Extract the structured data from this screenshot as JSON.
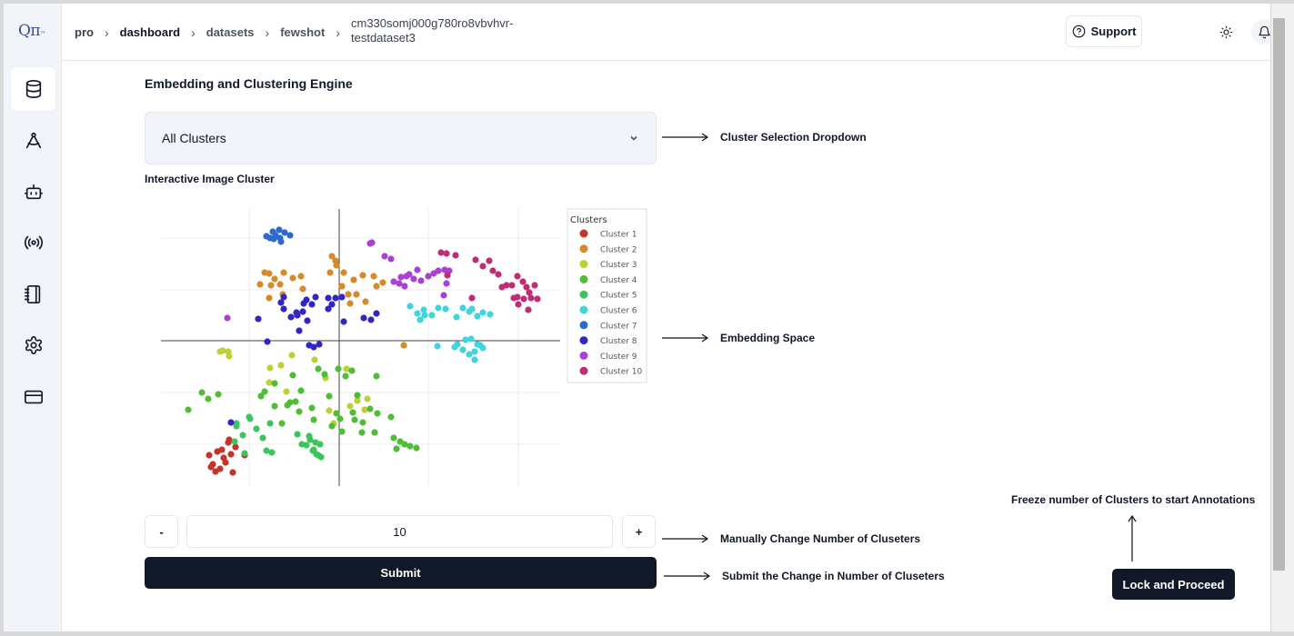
{
  "app": {
    "logo": "Qπ",
    "logo_sub": "™"
  },
  "breadcrumb": [
    "pro",
    "dashboard",
    "datasets",
    "fewshot",
    "cm330somj000g780ro8vbvhvr-testdataset3"
  ],
  "header": {
    "support_label": "Support"
  },
  "sidebar": {
    "items": [
      {
        "icon": "database-icon",
        "active": true
      },
      {
        "icon": "compass-icon",
        "active": false
      },
      {
        "icon": "bot-icon",
        "active": false
      },
      {
        "icon": "broadcast-icon",
        "active": false
      },
      {
        "icon": "notebook-icon",
        "active": false
      },
      {
        "icon": "settings-icon",
        "active": false
      },
      {
        "icon": "credit-card-icon",
        "active": false
      }
    ]
  },
  "main": {
    "title": "Embedding and Clustering Engine",
    "dropdown_value": "All Clusters",
    "cluster_title": "Interactive Image Cluster",
    "cluster_count": "10",
    "minus_label": "-",
    "plus_label": "+",
    "submit_label": "Submit",
    "lock_label": "Lock and Proceed"
  },
  "annotations": {
    "dropdown": "Cluster Selection Dropdown",
    "embedding": "Embedding Space",
    "change": "Manually Change Number of Cluseters",
    "submit": "Submit the Change in Number of Cluseters",
    "freeze": "Freeze number of Clusters to start Annotations"
  },
  "chart_data": {
    "type": "scatter",
    "legend_title": "Clusters",
    "legend_position": "right",
    "grid": true,
    "series": [
      {
        "name": "Cluster 1",
        "color": "#c4342a",
        "points": [
          [
            226,
            497
          ],
          [
            230,
            507
          ],
          [
            235,
            493
          ],
          [
            238,
            512
          ],
          [
            244,
            505
          ],
          [
            247,
            483
          ],
          [
            250,
            496
          ],
          [
            255,
            488
          ],
          [
            252,
            516
          ],
          [
            242,
            500
          ],
          [
            233,
            515
          ],
          [
            240,
            491
          ],
          [
            265,
            497
          ],
          [
            248,
            480
          ],
          [
            228,
            510
          ]
        ]
      },
      {
        "name": "Cluster 2",
        "color": "#d68a2c",
        "points": [
          [
            292,
            297
          ],
          [
            298,
            303
          ],
          [
            304,
            309
          ],
          [
            282,
            309
          ],
          [
            292,
            324
          ],
          [
            307,
            320
          ],
          [
            318,
            302
          ],
          [
            327,
            300
          ],
          [
            308,
            296
          ],
          [
            361,
            278
          ],
          [
            366,
            288
          ],
          [
            359,
            296
          ],
          [
            374,
            296
          ],
          [
            385,
            304
          ],
          [
            395,
            299
          ],
          [
            407,
            300
          ],
          [
            410,
            311
          ],
          [
            398,
            328
          ],
          [
            388,
            320
          ],
          [
            379,
            320
          ],
          [
            381,
            330
          ],
          [
            372,
            311
          ],
          [
            329,
            314
          ],
          [
            287,
            296
          ],
          [
            294,
            310
          ],
          [
            440,
            376
          ],
          [
            365,
            283
          ],
          [
            417,
            307
          ]
        ]
      },
      {
        "name": "Cluster 3",
        "color": "#bdd036",
        "points": [
          [
            241,
            382
          ],
          [
            248,
            388
          ],
          [
            238,
            383
          ],
          [
            342,
            392
          ],
          [
            377,
            402
          ],
          [
            317,
            387
          ],
          [
            305,
            398
          ],
          [
            293,
            401
          ],
          [
            292,
            417
          ],
          [
            311,
            427
          ],
          [
            400,
            435
          ],
          [
            389,
            437
          ],
          [
            381,
            443
          ],
          [
            397,
            447
          ],
          [
            363,
            462
          ],
          [
            354,
            412
          ],
          [
            358,
            448
          ],
          [
            247,
            383
          ]
        ]
      },
      {
        "name": "Cluster 4",
        "color": "#4fbe36",
        "points": [
          [
            203,
            447
          ],
          [
            218,
            428
          ],
          [
            225,
            435
          ],
          [
            236,
            430
          ],
          [
            283,
            432
          ],
          [
            287,
            427
          ],
          [
            298,
            418
          ],
          [
            318,
            409
          ],
          [
            327,
            426
          ],
          [
            346,
            402
          ],
          [
            353,
            408
          ],
          [
            368,
            402
          ],
          [
            376,
            410
          ],
          [
            383,
            404
          ],
          [
            410,
            410
          ],
          [
            325,
            449
          ],
          [
            315,
            439
          ],
          [
            321,
            438
          ],
          [
            339,
            445
          ],
          [
            341,
            458
          ],
          [
            358,
            432
          ],
          [
            366,
            451
          ],
          [
            361,
            465
          ],
          [
            370,
            457
          ],
          [
            384,
            450
          ],
          [
            386,
            458
          ],
          [
            389,
            431
          ],
          [
            395,
            461
          ],
          [
            403,
            446
          ],
          [
            411,
            451
          ],
          [
            408,
            472
          ],
          [
            394,
            472
          ],
          [
            426,
            455
          ],
          [
            429,
            478
          ],
          [
            432,
            490
          ],
          [
            436,
            482
          ],
          [
            441,
            485
          ],
          [
            447,
            487
          ],
          [
            454,
            489
          ],
          [
            312,
            442
          ],
          [
            298,
            443
          ],
          [
            372,
            471
          ],
          [
            306,
            462
          ]
        ]
      },
      {
        "name": "Cluster 5",
        "color": "#3cc55d",
        "points": [
          [
            256,
            462
          ],
          [
            263,
            475
          ],
          [
            254,
            482
          ],
          [
            271,
            457
          ],
          [
            278,
            468
          ],
          [
            285,
            478
          ],
          [
            293,
            462
          ],
          [
            289,
            492
          ],
          [
            295,
            494
          ],
          [
            265,
            495
          ],
          [
            323,
            474
          ],
          [
            328,
            485
          ],
          [
            333,
            486
          ],
          [
            337,
            480
          ],
          [
            343,
            483
          ],
          [
            346,
            497
          ],
          [
            341,
            491
          ],
          [
            348,
            485
          ],
          [
            344,
            496
          ],
          [
            340,
            492
          ],
          [
            349,
            499
          ],
          [
            336,
            476
          ],
          [
            270,
            455
          ],
          [
            256,
            465
          ]
        ]
      },
      {
        "name": "Cluster 6",
        "color": "#41d4dc",
        "points": [
          [
            447,
            333
          ],
          [
            455,
            341
          ],
          [
            463,
            343
          ],
          [
            471,
            343
          ],
          [
            478,
            335
          ],
          [
            486,
            336
          ],
          [
            498,
            345
          ],
          [
            505,
            335
          ],
          [
            512,
            339
          ],
          [
            521,
            344
          ],
          [
            527,
            340
          ],
          [
            535,
            342
          ],
          [
            508,
            370
          ],
          [
            514,
            369
          ],
          [
            521,
            375
          ],
          [
            527,
            379
          ],
          [
            518,
            383
          ],
          [
            512,
            386
          ],
          [
            505,
            381
          ],
          [
            496,
            378
          ],
          [
            499,
            375
          ],
          [
            518,
            392
          ],
          [
            477,
            377
          ],
          [
            515,
            336
          ],
          [
            462,
            337
          ],
          [
            524,
            376
          ],
          [
            458,
            348
          ]
        ]
      },
      {
        "name": "Cluster 7",
        "color": "#2e6acb",
        "points": [
          [
            296,
            251
          ],
          [
            303,
            249
          ],
          [
            309,
            252
          ],
          [
            315,
            255
          ],
          [
            304,
            258
          ],
          [
            297,
            259
          ],
          [
            293,
            258
          ],
          [
            299,
            255
          ],
          [
            289,
            256
          ],
          [
            305,
            262
          ]
        ]
      },
      {
        "name": "Cluster 8",
        "color": "#3126c1",
        "points": [
          [
            280,
            347
          ],
          [
            290,
            372
          ],
          [
            305,
            329
          ],
          [
            308,
            323
          ],
          [
            316,
            345
          ],
          [
            323,
            343
          ],
          [
            329,
            339
          ],
          [
            333,
            326
          ],
          [
            339,
            331
          ],
          [
            343,
            323
          ],
          [
            357,
            324
          ],
          [
            361,
            331
          ],
          [
            365,
            324
          ],
          [
            372,
            323
          ],
          [
            357,
            336
          ],
          [
            334,
            349
          ],
          [
            325,
            360
          ],
          [
            336,
            376
          ],
          [
            341,
            378
          ],
          [
            347,
            375
          ],
          [
            374,
            350
          ],
          [
            396,
            346
          ],
          [
            404,
            348
          ],
          [
            410,
            341
          ],
          [
            330,
            330
          ],
          [
            250,
            461
          ],
          [
            322,
            340
          ],
          [
            308,
            336
          ]
        ]
      },
      {
        "name": "Cluster 9",
        "color": "#aa40d4",
        "points": [
          [
            403,
            264
          ],
          [
            419,
            278
          ],
          [
            426,
            281
          ],
          [
            429,
            306
          ],
          [
            435,
            308
          ],
          [
            437,
            301
          ],
          [
            441,
            311
          ],
          [
            446,
            298
          ],
          [
            451,
            303
          ],
          [
            459,
            305
          ],
          [
            467,
            300
          ],
          [
            473,
            297
          ],
          [
            478,
            294
          ],
          [
            485,
            293
          ],
          [
            490,
            294
          ],
          [
            487,
            308
          ],
          [
            484,
            321
          ],
          [
            455,
            293
          ],
          [
            443,
            300
          ],
          [
            246,
            346
          ],
          [
            405,
            263
          ]
        ]
      },
      {
        "name": "Cluster 10",
        "color": "#bd2e77",
        "points": [
          [
            481,
            274
          ],
          [
            487,
            275
          ],
          [
            497,
            277
          ],
          [
            519,
            282
          ],
          [
            527,
            289
          ],
          [
            534,
            283
          ],
          [
            538,
            294
          ],
          [
            544,
            298
          ],
          [
            548,
            312
          ],
          [
            553,
            310
          ],
          [
            559,
            310
          ],
          [
            565,
            300
          ],
          [
            571,
            306
          ],
          [
            575,
            312
          ],
          [
            578,
            318
          ],
          [
            584,
            310
          ],
          [
            580,
            324
          ],
          [
            572,
            325
          ],
          [
            565,
            323
          ],
          [
            566,
            331
          ],
          [
            577,
            337
          ],
          [
            587,
            325
          ],
          [
            561,
            324
          ],
          [
            515,
            324
          ],
          [
            488,
            299
          ]
        ]
      }
    ]
  }
}
